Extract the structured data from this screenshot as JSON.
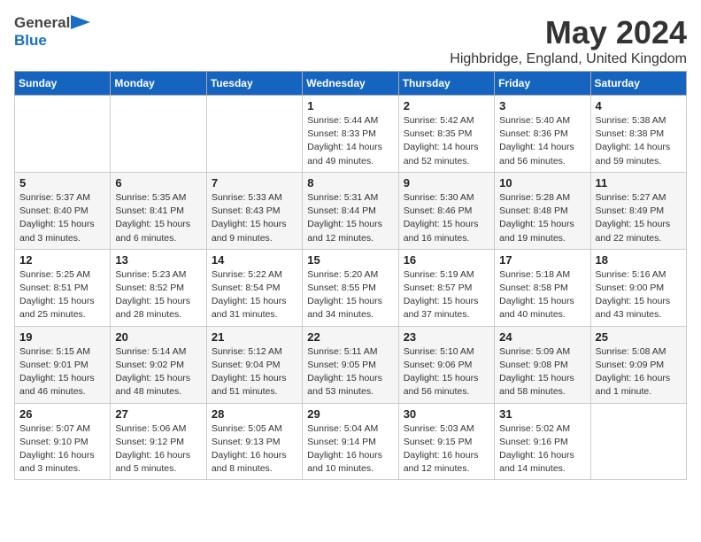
{
  "header": {
    "logo_general": "General",
    "logo_blue": "Blue",
    "month_year": "May 2024",
    "location": "Highbridge, England, United Kingdom"
  },
  "days_of_week": [
    "Sunday",
    "Monday",
    "Tuesday",
    "Wednesday",
    "Thursday",
    "Friday",
    "Saturday"
  ],
  "weeks": [
    [
      {
        "day": "",
        "info": ""
      },
      {
        "day": "",
        "info": ""
      },
      {
        "day": "",
        "info": ""
      },
      {
        "day": "1",
        "info": "Sunrise: 5:44 AM\nSunset: 8:33 PM\nDaylight: 14 hours\nand 49 minutes."
      },
      {
        "day": "2",
        "info": "Sunrise: 5:42 AM\nSunset: 8:35 PM\nDaylight: 14 hours\nand 52 minutes."
      },
      {
        "day": "3",
        "info": "Sunrise: 5:40 AM\nSunset: 8:36 PM\nDaylight: 14 hours\nand 56 minutes."
      },
      {
        "day": "4",
        "info": "Sunrise: 5:38 AM\nSunset: 8:38 PM\nDaylight: 14 hours\nand 59 minutes."
      }
    ],
    [
      {
        "day": "5",
        "info": "Sunrise: 5:37 AM\nSunset: 8:40 PM\nDaylight: 15 hours\nand 3 minutes."
      },
      {
        "day": "6",
        "info": "Sunrise: 5:35 AM\nSunset: 8:41 PM\nDaylight: 15 hours\nand 6 minutes."
      },
      {
        "day": "7",
        "info": "Sunrise: 5:33 AM\nSunset: 8:43 PM\nDaylight: 15 hours\nand 9 minutes."
      },
      {
        "day": "8",
        "info": "Sunrise: 5:31 AM\nSunset: 8:44 PM\nDaylight: 15 hours\nand 12 minutes."
      },
      {
        "day": "9",
        "info": "Sunrise: 5:30 AM\nSunset: 8:46 PM\nDaylight: 15 hours\nand 16 minutes."
      },
      {
        "day": "10",
        "info": "Sunrise: 5:28 AM\nSunset: 8:48 PM\nDaylight: 15 hours\nand 19 minutes."
      },
      {
        "day": "11",
        "info": "Sunrise: 5:27 AM\nSunset: 8:49 PM\nDaylight: 15 hours\nand 22 minutes."
      }
    ],
    [
      {
        "day": "12",
        "info": "Sunrise: 5:25 AM\nSunset: 8:51 PM\nDaylight: 15 hours\nand 25 minutes."
      },
      {
        "day": "13",
        "info": "Sunrise: 5:23 AM\nSunset: 8:52 PM\nDaylight: 15 hours\nand 28 minutes."
      },
      {
        "day": "14",
        "info": "Sunrise: 5:22 AM\nSunset: 8:54 PM\nDaylight: 15 hours\nand 31 minutes."
      },
      {
        "day": "15",
        "info": "Sunrise: 5:20 AM\nSunset: 8:55 PM\nDaylight: 15 hours\nand 34 minutes."
      },
      {
        "day": "16",
        "info": "Sunrise: 5:19 AM\nSunset: 8:57 PM\nDaylight: 15 hours\nand 37 minutes."
      },
      {
        "day": "17",
        "info": "Sunrise: 5:18 AM\nSunset: 8:58 PM\nDaylight: 15 hours\nand 40 minutes."
      },
      {
        "day": "18",
        "info": "Sunrise: 5:16 AM\nSunset: 9:00 PM\nDaylight: 15 hours\nand 43 minutes."
      }
    ],
    [
      {
        "day": "19",
        "info": "Sunrise: 5:15 AM\nSunset: 9:01 PM\nDaylight: 15 hours\nand 46 minutes."
      },
      {
        "day": "20",
        "info": "Sunrise: 5:14 AM\nSunset: 9:02 PM\nDaylight: 15 hours\nand 48 minutes."
      },
      {
        "day": "21",
        "info": "Sunrise: 5:12 AM\nSunset: 9:04 PM\nDaylight: 15 hours\nand 51 minutes."
      },
      {
        "day": "22",
        "info": "Sunrise: 5:11 AM\nSunset: 9:05 PM\nDaylight: 15 hours\nand 53 minutes."
      },
      {
        "day": "23",
        "info": "Sunrise: 5:10 AM\nSunset: 9:06 PM\nDaylight: 15 hours\nand 56 minutes."
      },
      {
        "day": "24",
        "info": "Sunrise: 5:09 AM\nSunset: 9:08 PM\nDaylight: 15 hours\nand 58 minutes."
      },
      {
        "day": "25",
        "info": "Sunrise: 5:08 AM\nSunset: 9:09 PM\nDaylight: 16 hours\nand 1 minute."
      }
    ],
    [
      {
        "day": "26",
        "info": "Sunrise: 5:07 AM\nSunset: 9:10 PM\nDaylight: 16 hours\nand 3 minutes."
      },
      {
        "day": "27",
        "info": "Sunrise: 5:06 AM\nSunset: 9:12 PM\nDaylight: 16 hours\nand 5 minutes."
      },
      {
        "day": "28",
        "info": "Sunrise: 5:05 AM\nSunset: 9:13 PM\nDaylight: 16 hours\nand 8 minutes."
      },
      {
        "day": "29",
        "info": "Sunrise: 5:04 AM\nSunset: 9:14 PM\nDaylight: 16 hours\nand 10 minutes."
      },
      {
        "day": "30",
        "info": "Sunrise: 5:03 AM\nSunset: 9:15 PM\nDaylight: 16 hours\nand 12 minutes."
      },
      {
        "day": "31",
        "info": "Sunrise: 5:02 AM\nSunset: 9:16 PM\nDaylight: 16 hours\nand 14 minutes."
      },
      {
        "day": "",
        "info": ""
      }
    ]
  ]
}
